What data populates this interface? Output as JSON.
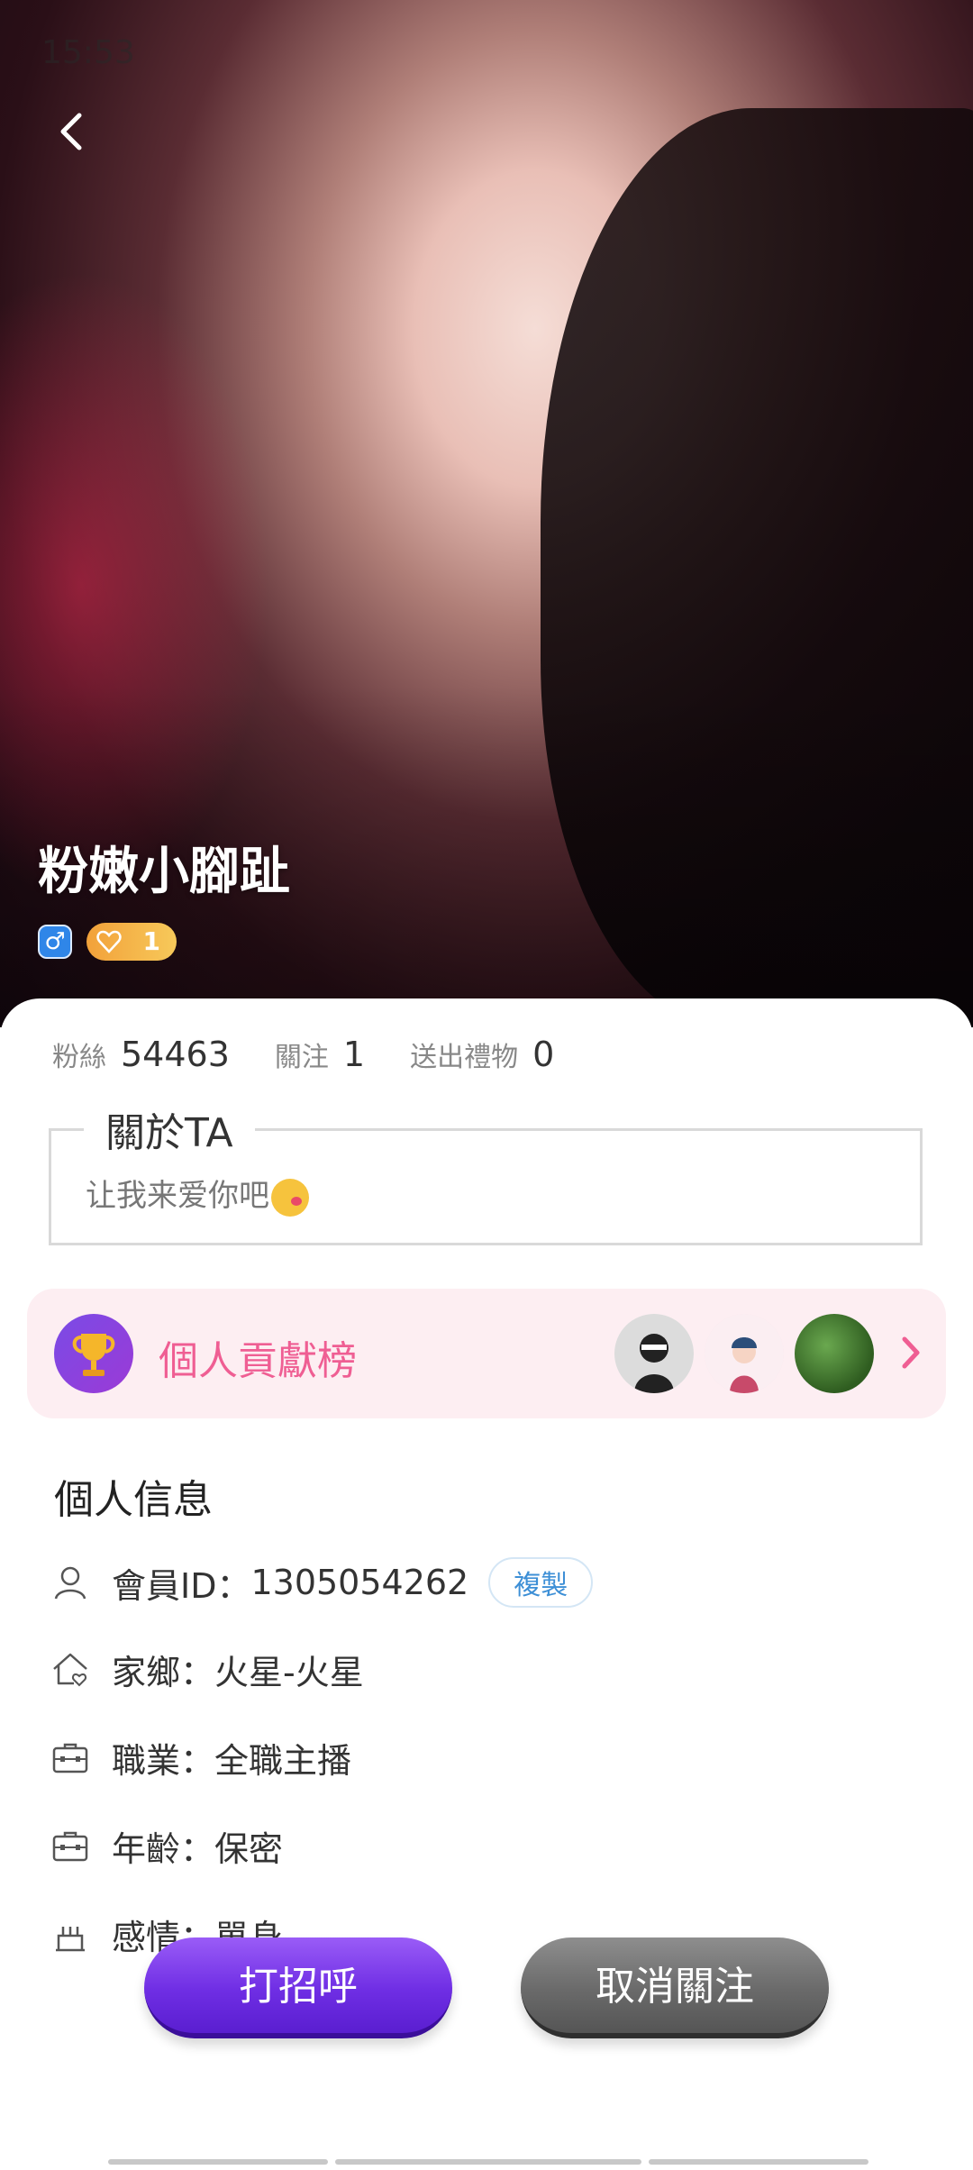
{
  "status_bar": {
    "time": "15:53",
    "right_text": ""
  },
  "profile": {
    "name": "粉嫩小腳趾",
    "gender_symbol": "♂",
    "level": "1"
  },
  "stats": [
    {
      "label": "粉絲",
      "value": "54463"
    },
    {
      "label": "關注",
      "value": "1"
    },
    {
      "label": "送出禮物",
      "value": "0"
    }
  ],
  "about": {
    "title": "關於TA",
    "text": "让我来爱你吧"
  },
  "ranking": {
    "label": "個人貢獻榜",
    "avatars": [
      "avatar-1",
      "avatar-2",
      "avatar-3"
    ]
  },
  "info": {
    "title": "個人信息",
    "rows": [
      {
        "label": "會員ID：",
        "value": "1305054262",
        "icon": "user-icon"
      },
      {
        "label": "家鄉：",
        "value": "火星-火星",
        "icon": "home-icon"
      },
      {
        "label": "職業：",
        "value": "全職主播",
        "icon": "briefcase-icon"
      },
      {
        "label": "年齡：",
        "value": "保密",
        "icon": "briefcase-icon"
      },
      {
        "label": "感情：",
        "value": "單身",
        "icon": "cake-icon"
      }
    ],
    "copy_label": "複製"
  },
  "actions": {
    "greet": "打招呼",
    "unfollow": "取消關注"
  },
  "colors": {
    "accent_pink": "#ef5e93",
    "button_purple": "#6f2ee4",
    "button_gray": "#6a6a6a",
    "link_blue": "#3d8fd6"
  }
}
